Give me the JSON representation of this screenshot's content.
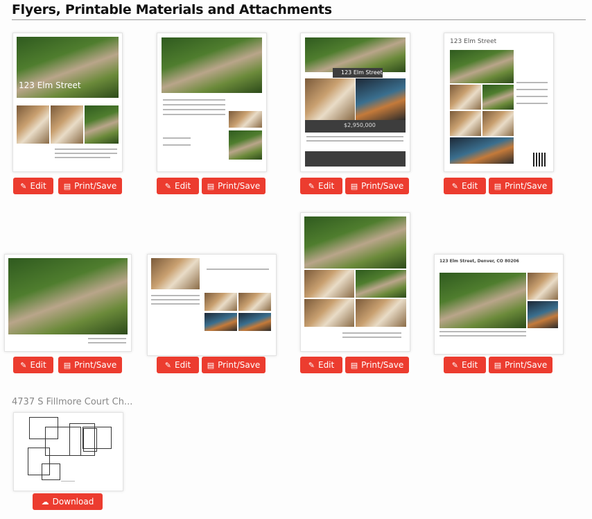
{
  "section_title": "Flyers, Printable Materials and Attachments",
  "buttons": {
    "edit": "Edit",
    "print_save": "Print/Save",
    "download": "Download"
  },
  "icons": {
    "edit": "pencil-icon",
    "print_save": "pdf-document-icon",
    "download": "cloud-download-icon"
  },
  "flyers": [
    {
      "headline": "123 Elm Street"
    },
    {
      "headline": ""
    },
    {
      "headline": "123 Elm Street",
      "price": "$2,950,000"
    },
    {
      "headline": "123 Elm Street"
    },
    {
      "headline": ""
    },
    {
      "headline": ""
    },
    {
      "headline": ""
    },
    {
      "headline": "123 Elm Street, Denver, CO 80206"
    }
  ],
  "attachments": [
    {
      "name": "4737 S Fillmore Court Ch..."
    }
  ],
  "colors": {
    "accent": "#ec3c2f",
    "title": "#111111"
  }
}
